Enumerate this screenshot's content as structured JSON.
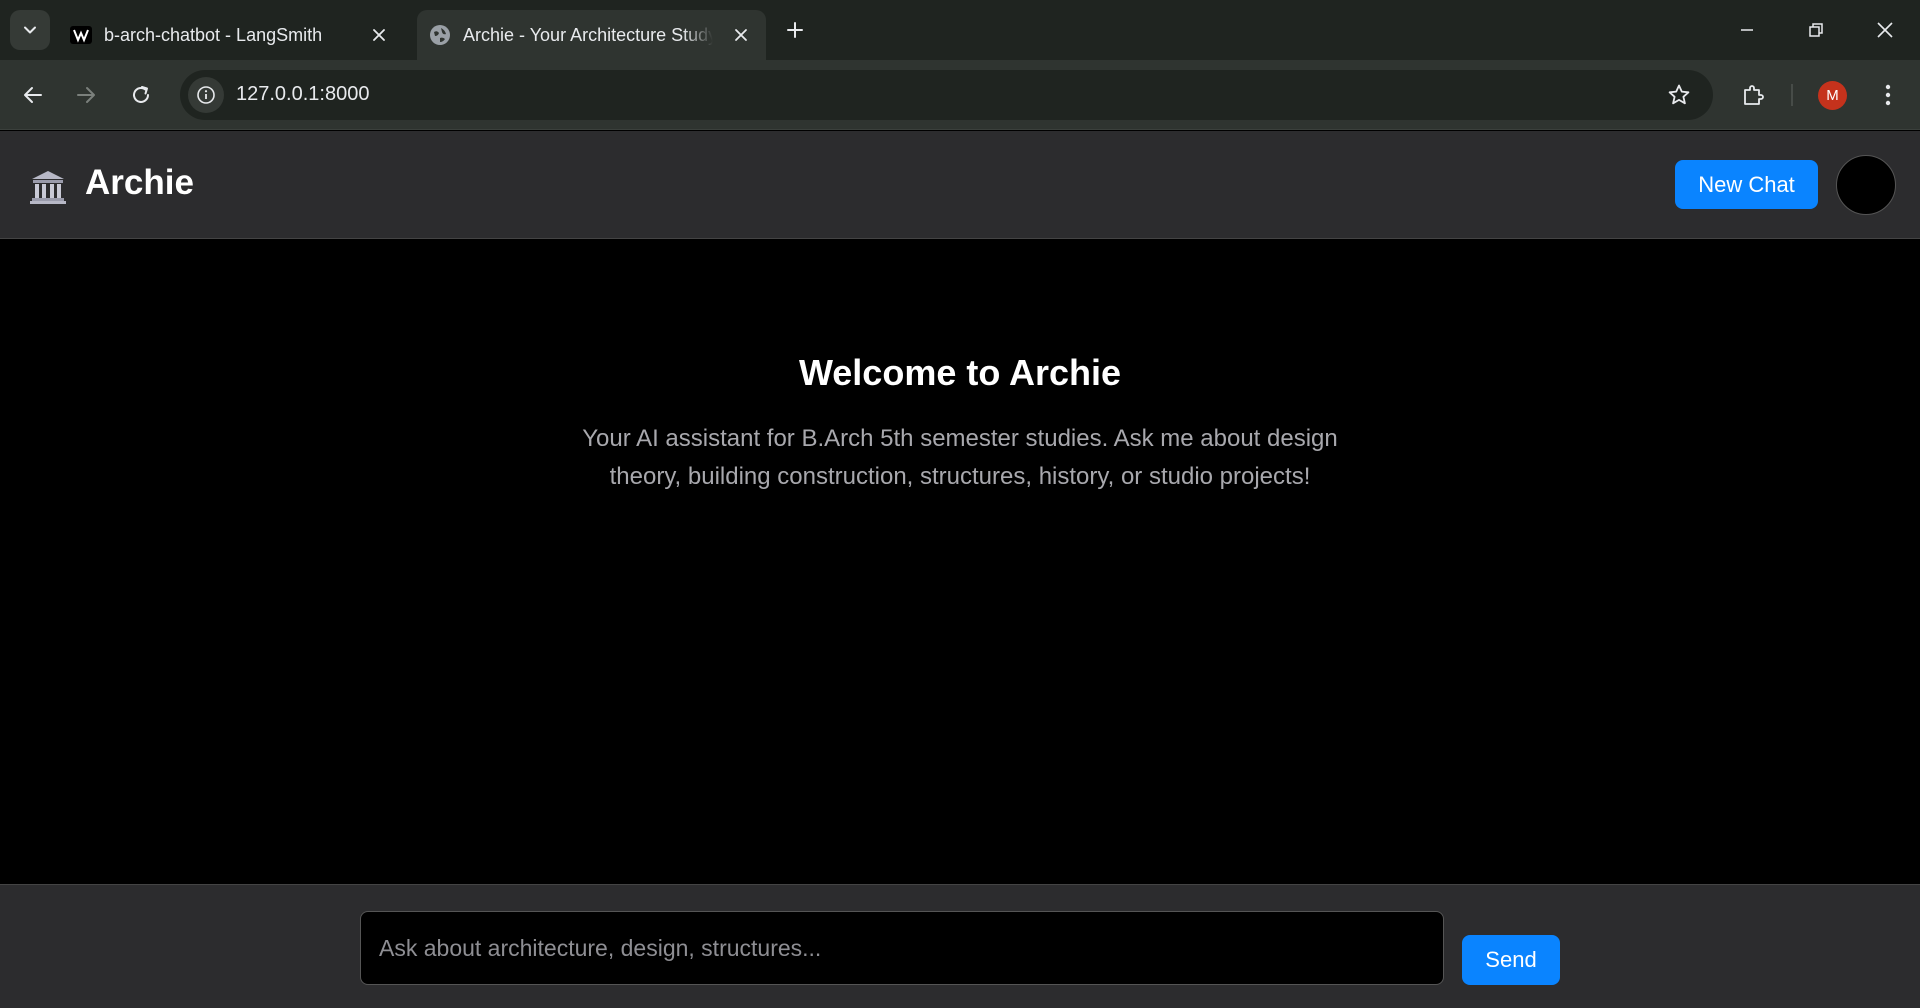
{
  "browser": {
    "tabs": [
      {
        "title": "b-arch-chatbot - LangSmith",
        "favicon": "langsmith-icon",
        "active": false
      },
      {
        "title": "Archie - Your Architecture Study",
        "favicon": "globe-icon",
        "active": true
      }
    ],
    "url": "127.0.0.1:8000",
    "profile_initial": "M",
    "colors": {
      "profile": "#c5321c",
      "frame": "#1f2420",
      "toolbar": "#2f3430"
    }
  },
  "header": {
    "logo_icon": "classical-building-icon",
    "title": "Archie",
    "new_chat_label": "New Chat"
  },
  "welcome": {
    "title": "Welcome to Archie",
    "subtitle": "Your AI assistant for B.Arch 5th semester studies. Ask me about design theory, building construction, structures, history, or studio projects!"
  },
  "composer": {
    "placeholder": "Ask about architecture, design, structures...",
    "value": "",
    "send_label": "Send"
  },
  "colors": {
    "accent": "#0a84ff",
    "header_bg": "#2c2c2e",
    "main_bg": "#000000"
  }
}
